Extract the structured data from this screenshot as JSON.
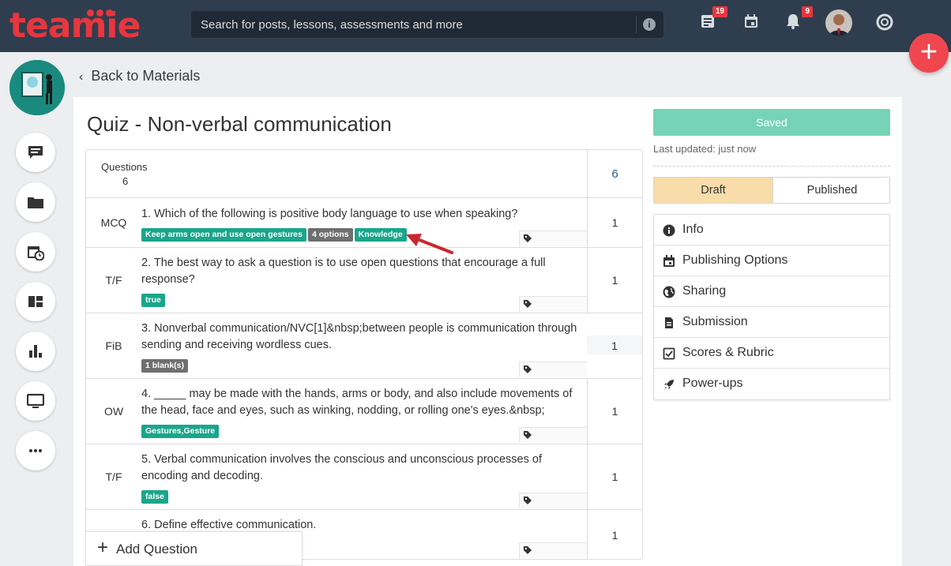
{
  "brand": {
    "name": "teamie",
    "color": "#e8363f"
  },
  "search": {
    "placeholder": "Search for posts, lessons, assessments and more"
  },
  "topbar": {
    "posts_badge": "19",
    "notifications_badge": "9"
  },
  "nav": {
    "back_label": "Back to Materials"
  },
  "quiz": {
    "title": "Quiz - Non-verbal communication",
    "questions_header": "Questions",
    "questions_count": "6",
    "total_points": "6",
    "questions": [
      {
        "type": "MCQ",
        "text": "1. Which of the following is positive body language to use when speaking?",
        "tags": [
          {
            "label": "Keep arms open and use open gestures",
            "color": "green"
          },
          {
            "label": "4 options",
            "color": "grey"
          },
          {
            "label": "Knowledge",
            "color": "green"
          }
        ],
        "points": "1"
      },
      {
        "type": "T/F",
        "text": "2. The best way to ask a question is to use open questions that encourage a full response?",
        "tags": [
          {
            "label": "true",
            "color": "green"
          }
        ],
        "points": "1"
      },
      {
        "type": "FiB",
        "text": "3. Nonverbal communication/NVC[1]&nbsp;between people is communication through sending and receiving wordless cues.",
        "tags": [
          {
            "label": "1 blank(s)",
            "color": "grey"
          }
        ],
        "points": "1"
      },
      {
        "type": "OW",
        "text": "4. _____ may be made with the hands, arms or body, and also include movements of the head, face and eyes, such as winking, nodding, or rolling one's eyes.&nbsp;",
        "tags": [
          {
            "label": "Gestures,Gesture",
            "color": "green"
          }
        ],
        "points": "1"
      },
      {
        "type": "T/F",
        "text": "5. Verbal communication involves the conscious and unconscious processes of encoding and decoding.",
        "tags": [
          {
            "label": "false",
            "color": "green"
          }
        ],
        "points": "1"
      },
      {
        "type": "",
        "text": "6. Define effective communication.",
        "tags": [],
        "points": "1"
      }
    ],
    "add_question_label": "Add Question"
  },
  "sidebar": {
    "saved_label": "Saved",
    "last_updated": "Last updated: just now",
    "draft_label": "Draft",
    "published_label": "Published",
    "menu": [
      {
        "label": "Info",
        "icon": "info-icon"
      },
      {
        "label": "Publishing Options",
        "icon": "calendar-icon"
      },
      {
        "label": "Sharing",
        "icon": "globe-icon"
      },
      {
        "label": "Submission",
        "icon": "document-icon"
      },
      {
        "label": "Scores & Rubric",
        "icon": "checkbox-icon"
      },
      {
        "label": "Power-ups",
        "icon": "rocket-icon"
      }
    ]
  },
  "colors": {
    "topbar": "#2f3e4e",
    "saved": "#76d3b5",
    "draft": "#f8dca9",
    "tag_green": "#1aa68a",
    "tag_grey": "#6f6f6f",
    "fab": "#f0464f"
  }
}
